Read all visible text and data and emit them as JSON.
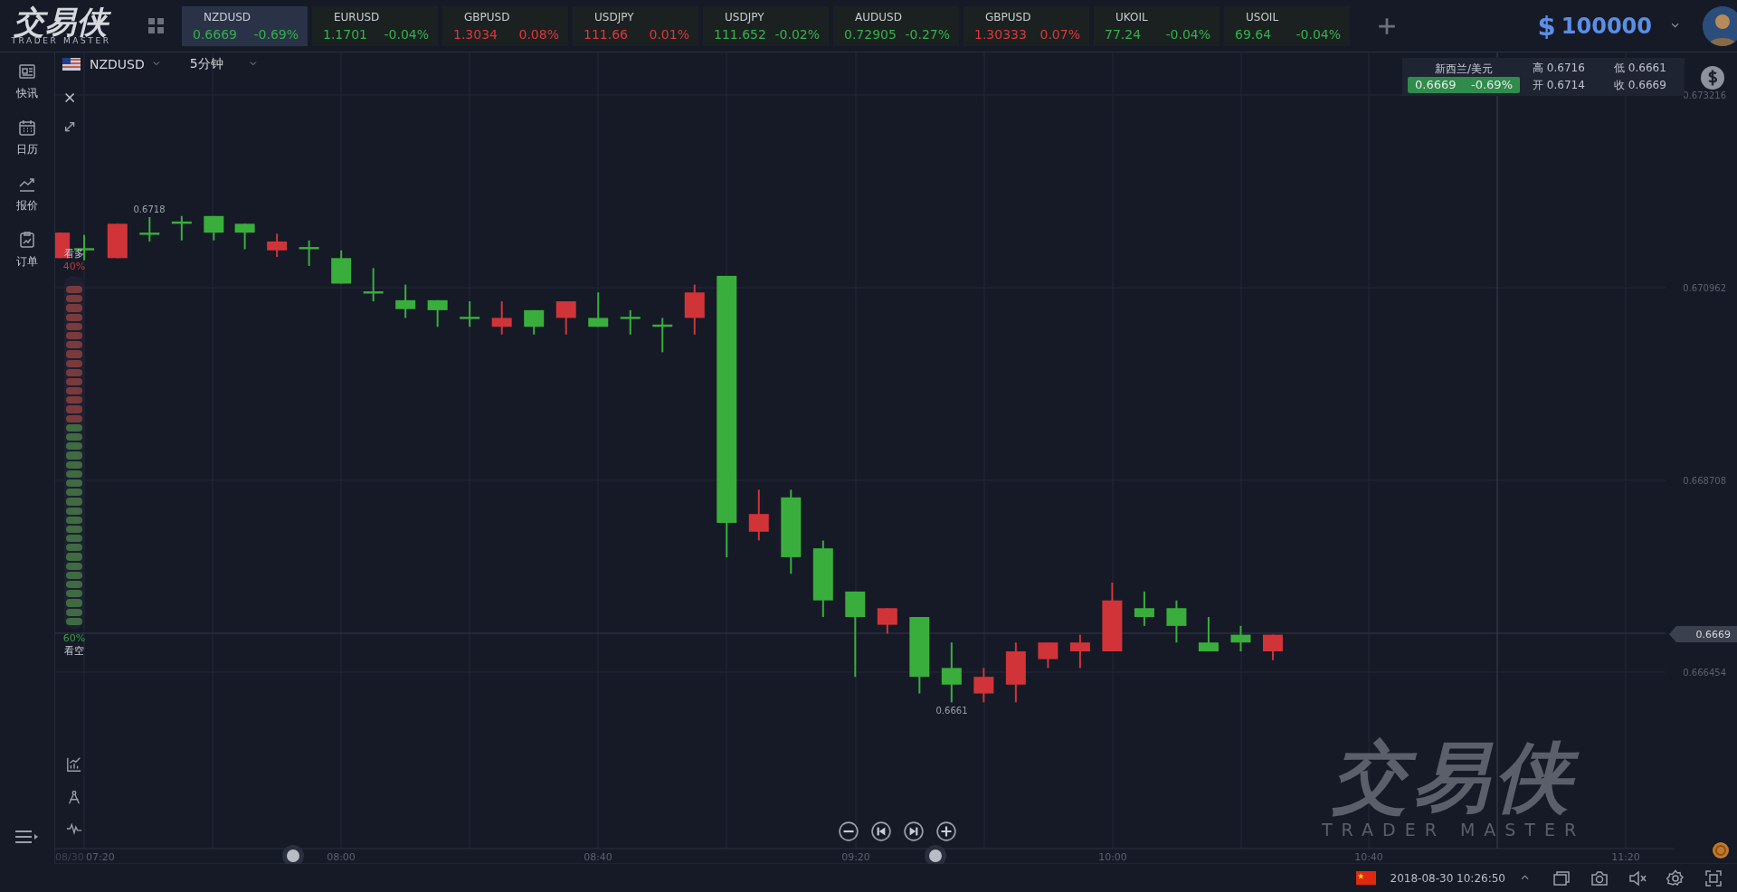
{
  "topbar": {
    "logo_title": "交易侠",
    "logo_subtitle": "TRADER MASTER",
    "tickers": [
      {
        "symbol": "NZDUSD",
        "price": "0.6669",
        "change": "-0.69%",
        "color": "#33b24a",
        "selected": true
      },
      {
        "symbol": "EURUSD",
        "price": "1.1701",
        "change": "-0.04%",
        "color": "#33b24a",
        "selected": false
      },
      {
        "symbol": "GBPUSD",
        "price": "1.3034",
        "change": "0.08%",
        "color": "#e0363b",
        "selected": false
      },
      {
        "symbol": "USDJPY",
        "price": "111.66",
        "change": "0.01%",
        "color": "#e0363b",
        "selected": false
      },
      {
        "symbol": "USDJPY",
        "price": "111.652",
        "change": "-0.02%",
        "color": "#33b24a",
        "selected": false
      },
      {
        "symbol": "AUDUSD",
        "price": "0.72905",
        "change": "-0.27%",
        "color": "#33b24a",
        "selected": false
      },
      {
        "symbol": "GBPUSD",
        "price": "1.30333",
        "change": "0.07%",
        "color": "#e0363b",
        "selected": false
      },
      {
        "symbol": "UKOIL",
        "price": "77.24",
        "change": "-0.04%",
        "color": "#33b24a",
        "selected": false
      },
      {
        "symbol": "USOIL",
        "price": "69.64",
        "change": "-0.04%",
        "color": "#33b24a",
        "selected": false
      }
    ],
    "currency_symbol": "$",
    "balance": "100000"
  },
  "sidebar": {
    "items": [
      {
        "label": "快讯",
        "kind": "news"
      },
      {
        "label": "日历",
        "kind": "calendar"
      },
      {
        "label": "报价",
        "kind": "quote"
      },
      {
        "label": "订单",
        "kind": "order"
      }
    ]
  },
  "chart_toolbar": {
    "symbol": "NZDUSD",
    "interval": "5分钟"
  },
  "info_box": {
    "title": "新西兰/美元",
    "price": "0.6669",
    "change": "-0.69%",
    "color": "#2f8c4a",
    "stats": [
      {
        "text": "高 0.6716"
      },
      {
        "text": "低 0.6661"
      },
      {
        "text": "开 0.6714"
      },
      {
        "text": "收 0.6669"
      }
    ]
  },
  "sentiment": {
    "bull_label": "看多",
    "bull_percent": "40%",
    "bear_percent": "60%",
    "bear_label": "看空",
    "level": 0.4
  },
  "chart": {
    "y_labels": [
      "0.673216",
      "0.670962",
      "0.668708",
      "0.666454"
    ],
    "x_labels": [
      "08/30",
      "07:20",
      "08:00",
      "08:40",
      "09:20",
      "10:00",
      "10:40",
      "11:20"
    ],
    "high_label": "0.6718",
    "low_label": "0.6661",
    "last_price": "0.6669",
    "watermark_title": "交易侠",
    "watermark_subtitle": "TRADER MASTER"
  },
  "status_bar": {
    "datetime": "2018-08-30 10:26:50"
  }
}
